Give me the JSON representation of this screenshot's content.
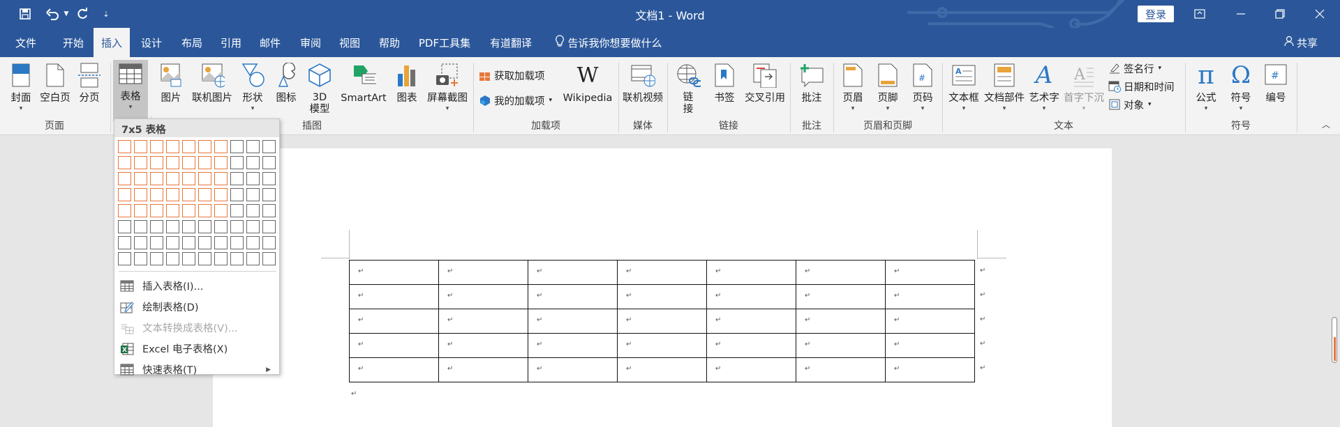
{
  "app": {
    "doc_title": "文档1 - Word",
    "login_label": "登录",
    "share_label": "共享"
  },
  "tabs": [
    {
      "label": "文件"
    },
    {
      "label": "开始"
    },
    {
      "label": "插入",
      "active": true
    },
    {
      "label": "设计"
    },
    {
      "label": "布局"
    },
    {
      "label": "引用"
    },
    {
      "label": "邮件"
    },
    {
      "label": "审阅"
    },
    {
      "label": "视图"
    },
    {
      "label": "帮助"
    },
    {
      "label": "PDF工具集"
    },
    {
      "label": "有道翻译"
    },
    {
      "label": "告诉我你想要做什么"
    }
  ],
  "ribbon": {
    "groups": {
      "pages": "页面",
      "illustrations": "插图",
      "addins": "加载项",
      "media": "媒体",
      "links": "链接",
      "comments": "批注",
      "header_footer": "页眉和页脚",
      "text": "文本",
      "symbols": "符号"
    },
    "buttons": {
      "cover": "封面",
      "blank_page": "空白页",
      "page_break": "分页",
      "table": "表格",
      "picture": "图片",
      "online_picture": "联机图片",
      "shapes": "形状",
      "icons": "图标",
      "model_3d_1": "3D",
      "model_3d_2": "模型",
      "smartart": "SmartArt",
      "chart": "图表",
      "screenshot": "屏幕截图",
      "get_addins": "获取加载项",
      "my_addins": "我的加载项",
      "wikipedia": "Wikipedia",
      "online_video": "联机视频",
      "link_1": "链",
      "link_2": "接",
      "bookmark": "书签",
      "cross_ref": "交叉引用",
      "comment": "批注",
      "header": "页眉",
      "footer": "页脚",
      "page_number": "页码",
      "text_box": "文本框",
      "quick_parts": "文档部件",
      "wordart": "艺术字",
      "drop_cap": "首字下沉",
      "signature_line": "签名行",
      "date_time": "日期和时间",
      "object": "对象",
      "equation": "公式",
      "symbol": "符号",
      "numbering": "编号"
    }
  },
  "table_menu": {
    "header": "7x5 表格",
    "grid_cols": 10,
    "grid_rows": 8,
    "selected_cols": 7,
    "selected_rows": 5,
    "items": [
      {
        "label": "插入表格(I)...",
        "disabled": false
      },
      {
        "label": "绘制表格(D)",
        "disabled": false
      },
      {
        "label": "文本转换成表格(V)...",
        "disabled": true
      },
      {
        "label": "Excel 电子表格(X)",
        "disabled": false
      },
      {
        "label": "快速表格(T)",
        "disabled": false
      }
    ]
  },
  "document": {
    "table_cols": 7,
    "table_rows": 5,
    "cell_mark": "↵"
  },
  "colors": {
    "title_bar": "#2b579a",
    "ribbon_bg": "#f3f3f3",
    "grid_highlight": "#e8763a"
  }
}
